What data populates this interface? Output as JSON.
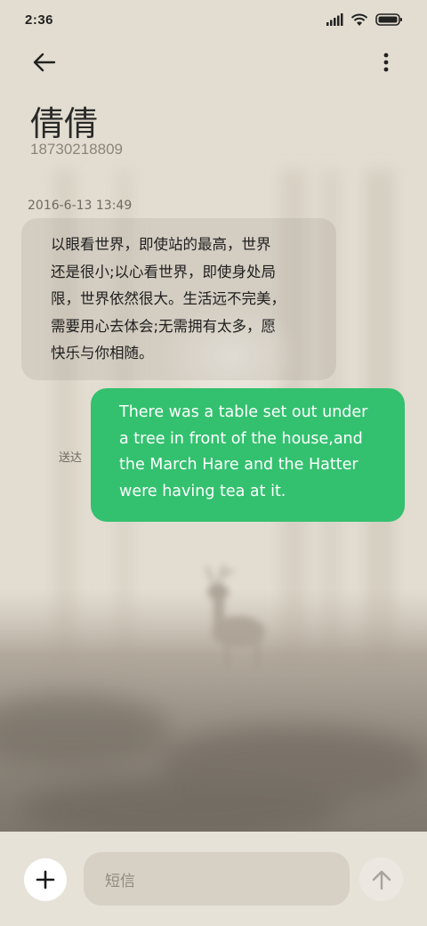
{
  "status_bar": {
    "time": "2:36",
    "icons": [
      "signal-icon",
      "wifi-icon",
      "battery-icon"
    ]
  },
  "header": {
    "back_icon": "arrow-left-icon",
    "more_icon": "vertical-dots-icon",
    "contact_name": "倩倩",
    "contact_number": "18730218809"
  },
  "conversation": {
    "timestamp": "2016-6-13 13:49",
    "messages": [
      {
        "direction": "incoming",
        "text": "以眼看世界，即使站的最高，世界\n还是很小;以心看世界，即使身处局\n限，世界依然很大。生活远不完美，\n需要用心去体会;无需拥有太多，愿\n快乐与你相随。"
      },
      {
        "direction": "outgoing",
        "text": "There was a table set out under\na tree in front of the house,and\nthe March Hare and the Hatter\nwere having tea at it.",
        "status": "送达"
      }
    ]
  },
  "composer": {
    "add_icon": "plus-icon",
    "placeholder": "短信",
    "send_icon": "arrow-up-icon"
  },
  "colors": {
    "background": "#e3ddd1",
    "outgoing_bubble": "#33c16f",
    "incoming_bubble": "rgba(160,152,140,0.22)"
  }
}
